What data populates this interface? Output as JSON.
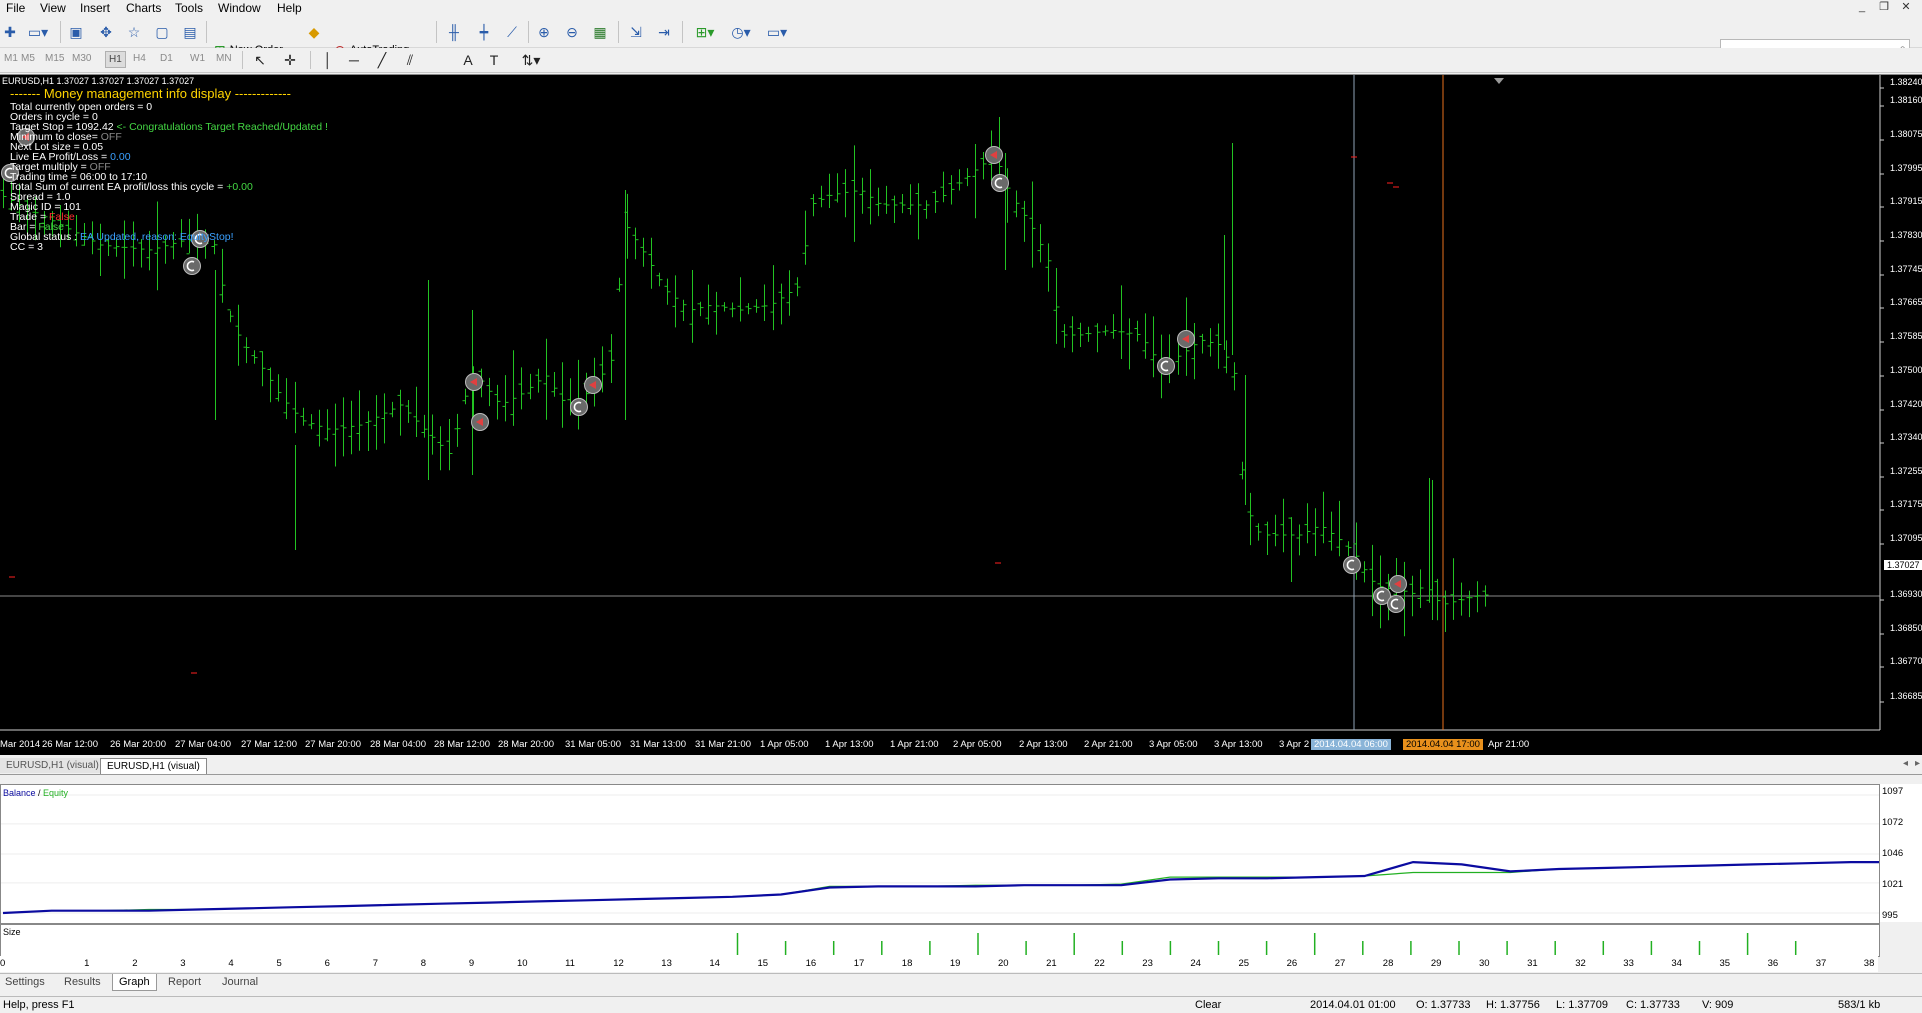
{
  "menu": [
    "File",
    "View",
    "Insert",
    "Charts",
    "Tools",
    "Window",
    "Help"
  ],
  "toolbar": {
    "new_order": "New Order",
    "autotrading": "AutoTrading",
    "timeframes": [
      "M1",
      "M5",
      "M15",
      "M30",
      "H1",
      "H4",
      "D1",
      "W1",
      "MN"
    ]
  },
  "chart": {
    "header": "EURUSD,H1  1.37027 1.37027 1.37027 1.37027",
    "info": {
      "title": "------- Money management info display -------------",
      "open_orders": "Total currently open orders = 0",
      "orders_in_cycle": "Orders in cycle = 0",
      "target_stop": "Target Stop = 1092.42",
      "target_stop_note": "<- Congratulations Target Reached/Updated !",
      "minimum_to_close_label": "Minimum to close= ",
      "minimum_to_close_value": "OFF",
      "next_lot": "Next Lot size = 0.05",
      "live_pl_label": "Live EA Profit/Loss = ",
      "live_pl_value": "0.00",
      "target_multiply_label": "Target multiply = ",
      "target_multiply_value": "OFF",
      "trading_time": "Trading time = 06:00 to 17:10",
      "total_sum_label": "Total Sum of current EA profit/loss this cycle = ",
      "total_sum_value": "+0.00",
      "spread": "Spread = 1.0",
      "magic": "Magic ID = 101",
      "trade_label": "Trade = ",
      "trade_value": "False",
      "bar_label": "Bar = ",
      "bar_value": "False",
      "global_label": "Global status : ",
      "global_value": "EA Updated, reason: EquityStop!",
      "cc": "CC = 3"
    },
    "price_labels": [
      "1.38240",
      "1.38160",
      "1.38075",
      "1.37995",
      "1.37915",
      "1.37830",
      "1.37745",
      "1.37665",
      "1.37585",
      "1.37500",
      "1.37420",
      "1.37340",
      "1.37255",
      "1.37175",
      "1.37095",
      "1.37027",
      "1.36930",
      "1.36850",
      "1.36770",
      "1.36685"
    ],
    "current_price": "1.37027",
    "time_labels": [
      "Mar 2014",
      "26 Mar 12:00",
      "26 Mar 20:00",
      "27 Mar 04:00",
      "27 Mar 12:00",
      "27 Mar 20:00",
      "28 Mar 04:00",
      "28 Mar 12:00",
      "28 Mar 20:00",
      "31 Mar 05:00",
      "31 Mar 13:00",
      "31 Mar 21:00",
      "1 Apr 05:00",
      "1 Apr 13:00",
      "1 Apr 21:00",
      "2 Apr 05:00",
      "2 Apr 13:00",
      "2 Apr 21:00",
      "3 Apr 05:00",
      "3 Apr 13:00",
      "3 Apr 2"
    ],
    "marker_blue": "2014.04.04 06:00",
    "marker_orange": "2014.04.04 17:00",
    "last_time": "Apr 21:00",
    "colors": {
      "bars": "#22c322",
      "background": "#000000",
      "blue_line": "#8fa3b8",
      "orange_line": "#e8701c"
    }
  },
  "chart_tabs": [
    "EURUSD,H1 (visual)",
    "EURUSD,H1 (visual)"
  ],
  "graph": {
    "legend_balance": "Balance",
    "legend_sep": " / ",
    "legend_equity": "Equity",
    "y_labels": [
      "1097",
      "1072",
      "1046",
      "1021",
      "995"
    ],
    "size_label": "Size",
    "x_labels": [
      "0",
      "1",
      "2",
      "3",
      "4",
      "5",
      "6",
      "7",
      "8",
      "9",
      "10",
      "11",
      "12",
      "13",
      "14",
      "15",
      "16",
      "17",
      "18",
      "19",
      "20",
      "21",
      "22",
      "23",
      "24",
      "25",
      "26",
      "27",
      "28",
      "29",
      "30",
      "31",
      "32",
      "33",
      "34",
      "35",
      "36",
      "37",
      "38"
    ],
    "colors": {
      "balance": "#0b0ba0",
      "equity": "#22b022"
    }
  },
  "bottom_tabs": [
    "Settings",
    "Results",
    "Graph",
    "Report",
    "Journal"
  ],
  "status": {
    "help": "Help, press F1",
    "clear": "Clear",
    "datetime": "2014.04.01 01:00",
    "open": "O: 1.37733",
    "high": "H: 1.37756",
    "low": "L: 1.37709",
    "close": "C: 1.37733",
    "volume": "V: 909",
    "traffic": "583/1 kb"
  }
}
